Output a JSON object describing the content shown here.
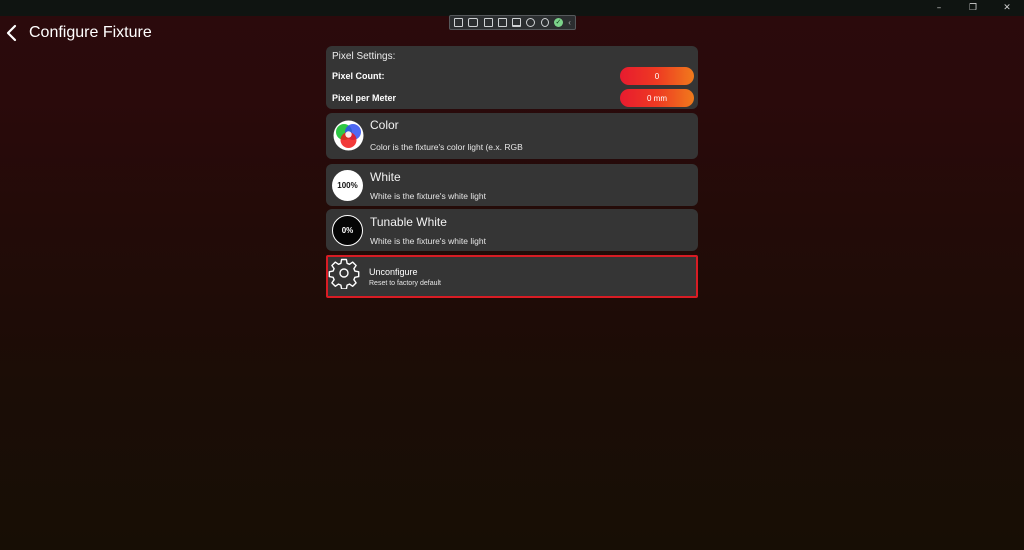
{
  "window": {
    "minimize_glyph": "–",
    "restore_glyph": "❐",
    "close_glyph": "✕"
  },
  "toolbar": {
    "icons": [
      "document-icon",
      "video-icon",
      "cast-icon",
      "frame-icon",
      "monitor-icon",
      "people-icon",
      "link-icon",
      "check-icon",
      "chevron-left-icon"
    ],
    "check_glyph": "✓",
    "chevron_glyph": "‹"
  },
  "header": {
    "title": "Configure Fixture"
  },
  "pixel_settings": {
    "title": "Pixel Settings:",
    "rows": [
      {
        "label": "Pixel Count:",
        "value": "0"
      },
      {
        "label": "Pixel per Meter",
        "value": "0 mm"
      }
    ]
  },
  "options": {
    "color": {
      "title": "Color",
      "description": "Color is the fixture's color light (e.x. RGB"
    },
    "white": {
      "title": "White",
      "description": "White is the fixture's white light",
      "badge": "100%"
    },
    "tunable_white": {
      "title": "Tunable White",
      "description": "White is the fixture's white light",
      "badge": "0%"
    },
    "unconfigure": {
      "title": "Unconfigure",
      "description": "Reset to factory default"
    }
  },
  "colors": {
    "accent_gradient_start": "#e81b2f",
    "accent_gradient_end": "#f07a1c",
    "card_bg": "#353535",
    "highlight_border": "#d81c24"
  }
}
